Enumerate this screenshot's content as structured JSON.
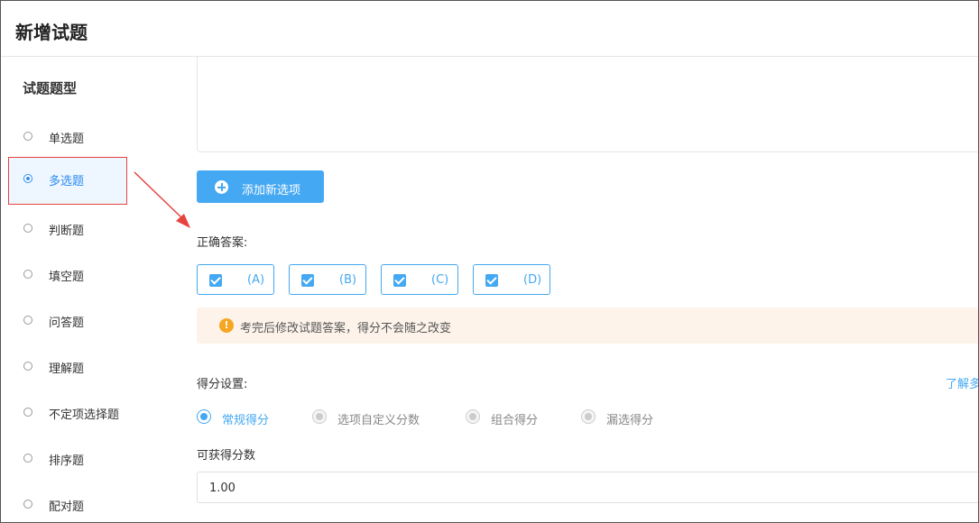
{
  "header": {
    "title": "新增试题"
  },
  "sidebar": {
    "title": "试题题型",
    "items": [
      {
        "label": "单选题"
      },
      {
        "label": "多选题"
      },
      {
        "label": "判断题"
      },
      {
        "label": "填空题"
      },
      {
        "label": "问答题"
      },
      {
        "label": "理解题"
      },
      {
        "label": "不定项选择题"
      },
      {
        "label": "排序题"
      },
      {
        "label": "配对题"
      }
    ]
  },
  "main": {
    "add_option_label": "添加新选项",
    "correct_answer_label": "正确答案:",
    "answers": [
      {
        "label": "(A)",
        "checked": true
      },
      {
        "label": "(B)",
        "checked": true
      },
      {
        "label": "(C)",
        "checked": true
      },
      {
        "label": "(D)",
        "checked": true
      }
    ],
    "notice_text": "考完后修改试题答案，得分不会随之改变",
    "score_settings_label": "得分设置:",
    "learn_more": "了解多",
    "score_options": [
      {
        "label": "常规得分",
        "selected": true
      },
      {
        "label": "选项自定义分数",
        "selected": false
      },
      {
        "label": "组合得分",
        "selected": false
      },
      {
        "label": "漏选得分",
        "selected": false
      }
    ],
    "score_value_label": "可获得分数",
    "score_value": "1.00"
  },
  "colors": {
    "accent": "#44a8f2",
    "highlight_border": "#e64340",
    "notice_bg": "#fdf3ea"
  }
}
